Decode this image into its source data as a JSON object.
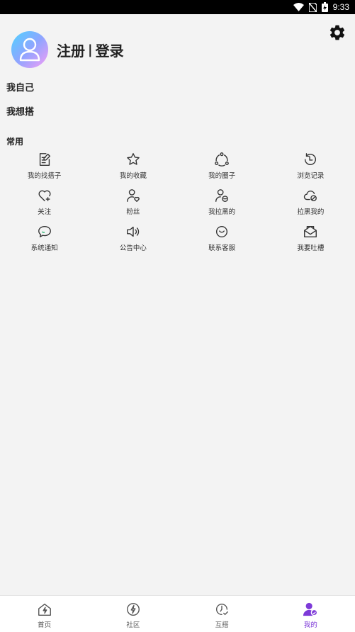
{
  "status_bar": {
    "time": "9:33"
  },
  "profile": {
    "login_text": "注册",
    "separator": "|",
    "register_text": "登录"
  },
  "links": {
    "myself": "我自己",
    "want_pair": "我想搭"
  },
  "common": {
    "title": "常用",
    "items": [
      {
        "label": "我的找搭子",
        "icon": "edit-note-icon"
      },
      {
        "label": "我的收藏",
        "icon": "star-icon"
      },
      {
        "label": "我的圈子",
        "icon": "circle-share-icon"
      },
      {
        "label": "浏览记录",
        "icon": "history-icon"
      },
      {
        "label": "关注",
        "icon": "heart-plus-icon"
      },
      {
        "label": "粉丝",
        "icon": "user-heart-icon"
      },
      {
        "label": "我拉黑的",
        "icon": "user-block-icon"
      },
      {
        "label": "拉黑我的",
        "icon": "cloud-block-icon"
      },
      {
        "label": "系统通知",
        "icon": "chat-bubble-icon"
      },
      {
        "label": "公告中心",
        "icon": "speaker-icon"
      },
      {
        "label": "联系客服",
        "icon": "smile-icon"
      },
      {
        "label": "我要吐槽",
        "icon": "mail-open-icon"
      }
    ]
  },
  "tabbar": {
    "accent": "#7d3ad8",
    "items": [
      {
        "label": "首页",
        "icon": "home-icon"
      },
      {
        "label": "社区",
        "icon": "lightning-circle-icon"
      },
      {
        "label": "互搭",
        "icon": "clock-check-icon"
      },
      {
        "label": "我的",
        "icon": "user-active-icon"
      }
    ]
  }
}
